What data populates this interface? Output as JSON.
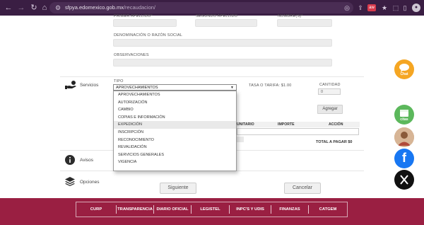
{
  "browser": {
    "url_host": "sfpya.edomexico.gob.mx",
    "url_path": "/recaudacion/",
    "ext_badge": "aw"
  },
  "form": {
    "labels": {
      "first_surname": "PRIMER APELLIDO*",
      "second_surname": "SEGUNDO APELLIDO",
      "names": "NOMBRE(S)*",
      "business_name": "DENOMINACIÓN O RAZÓN SOCIAL",
      "observations": "OBSERVACIONES"
    }
  },
  "sections": {
    "servicios": "Servicios",
    "avisos": "Avisos",
    "opciones": "Opciones"
  },
  "servicios": {
    "tipo_label": "TIPO",
    "selected": "APROVECHAMIENTOS",
    "options": [
      "APROVECHAMIENTOS",
      "AUTORIZACIÓN",
      "CAMBIO",
      "COPIAS E INFORMACIÓN",
      "EXPEDICIÓN",
      "INSCRIPCIÓN",
      "RECONOCIMIENTO",
      "REVALIDACIÓN",
      "SERVICIOS GENERALES",
      "VIGENCIA"
    ],
    "highlighted_option": "EXPEDICIÓN",
    "tasa": "TASA O TARIFA: $1.00",
    "cantidad_label": "CANTIDAD",
    "cantidad_value": "0",
    "agregar": "Agregar",
    "table_headers": [
      "UNITARIO",
      "IMPORTE",
      "ACCIÓN"
    ],
    "total": "TOTAL A PAGAR $0"
  },
  "buttons": {
    "siguiente": "Siguiente",
    "cancelar": "Cancelar"
  },
  "footer": {
    "items": [
      "CURP",
      "TRANSPARENCIA",
      "DIARIO OFICIAL",
      "LEGISTEL",
      "INPC'S Y UDIS",
      "FINANZAS",
      "CATGEM"
    ]
  },
  "floating": {
    "chat_label": "Chat",
    "citas_label": "citas"
  },
  "colors": {
    "footer_bg": "#9a1f42",
    "chat": "#f5a623",
    "citas": "#5cb85c",
    "facebook": "#1877f2",
    "x": "#111111"
  }
}
